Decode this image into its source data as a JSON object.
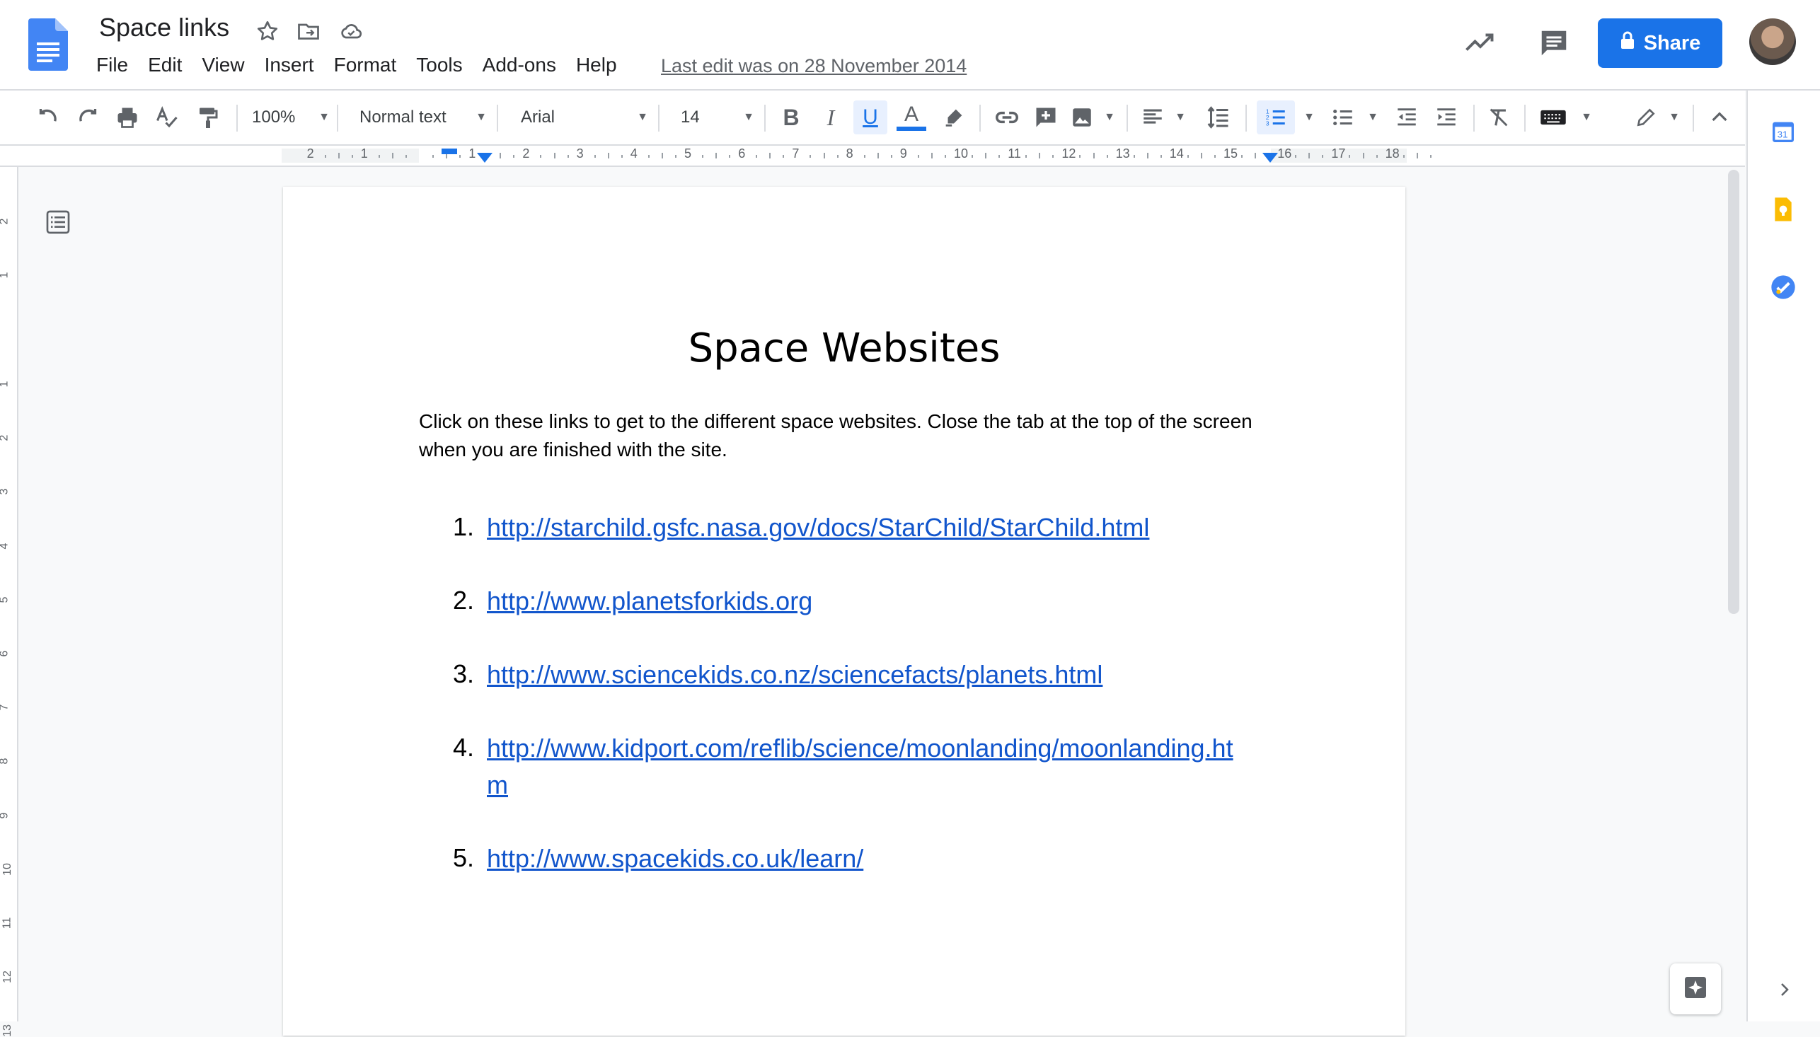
{
  "header": {
    "doc_title": "Space links",
    "menu": [
      "File",
      "Edit",
      "View",
      "Insert",
      "Format",
      "Tools",
      "Add-ons",
      "Help"
    ],
    "last_edit": "Last edit was on 28 November 2014",
    "share_label": "Share",
    "share_color": "#1a73e8"
  },
  "toolbar": {
    "zoom": "100%",
    "style": "Normal text",
    "font": "Arial",
    "font_size": "14"
  },
  "ruler": {
    "numbers": [
      "2",
      "1",
      "1",
      "2",
      "3",
      "4",
      "5",
      "6",
      "7",
      "8",
      "9",
      "10",
      "11",
      "12",
      "13",
      "14",
      "15",
      "16",
      "17",
      "18"
    ]
  },
  "vertical_ruler": {
    "numbers": [
      "2",
      "1",
      "1",
      "2",
      "3",
      "4",
      "5",
      "6",
      "7",
      "8",
      "9",
      "10",
      "11",
      "12",
      "13"
    ]
  },
  "document": {
    "heading": "Space Websites",
    "intro": "Click on these links to get to the different space websites. Close the tab at the top of the screen when you are finished with the site.",
    "links": [
      {
        "num": "1.",
        "url": "http://starchild.gsfc.nasa.gov/docs/StarChild/StarChild.html"
      },
      {
        "num": "2.",
        "url": "http://www.planetsforkids.org"
      },
      {
        "num": "3.",
        "url": "http://www.sciencekids.co.nz/sciencefacts/planets.html"
      },
      {
        "num": "4.",
        "url": "http://www.kidport.com/reflib/science/moonlanding/moonlanding.ht",
        "url_cont": "m"
      },
      {
        "num": "5.",
        "url": "http://www.spacekids.co.uk/learn/"
      }
    ],
    "link_color": "#1155cc"
  },
  "icons": [
    "docs-logo",
    "star-icon",
    "move-to-folder-icon",
    "cloud-saved-icon",
    "activity-icon",
    "comments-icon",
    "lock-icon",
    "undo-icon",
    "redo-icon",
    "print-icon",
    "spellcheck-icon",
    "paint-format-icon",
    "bold-icon",
    "italic-icon",
    "underline-icon",
    "text-color-icon",
    "highlight-icon",
    "link-icon",
    "add-comment-icon",
    "image-icon",
    "align-left-icon",
    "line-spacing-icon",
    "numbered-list-icon",
    "bulleted-list-icon",
    "decrease-indent-icon",
    "increase-indent-icon",
    "clear-formatting-icon",
    "input-tools-icon",
    "editing-mode-icon",
    "collapse-menu-icon",
    "outline-icon",
    "calendar-icon",
    "keep-icon",
    "tasks-icon",
    "explore-icon",
    "expand-panel-icon"
  ]
}
